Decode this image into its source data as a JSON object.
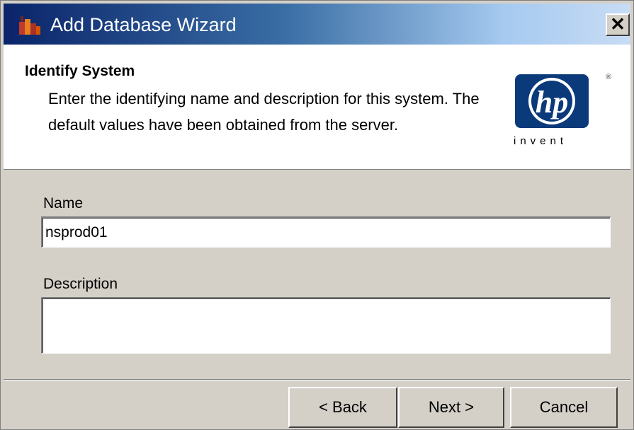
{
  "window": {
    "title": "Add Database Wizard",
    "close_glyph": "✕",
    "app_icon": "database-icon"
  },
  "header": {
    "title": "Identify System",
    "description": "Enter the identifying name and description for this system. The default values have been obtained from the server.",
    "logo": {
      "mark": "hp",
      "tagline": "invent",
      "registered": "®",
      "brand_color": "#0a3a7a"
    }
  },
  "form": {
    "name_label": "Name",
    "name_value": "nsprod01",
    "description_label": "Description",
    "description_value": ""
  },
  "buttons": {
    "back": "< Back",
    "next": "Next >",
    "cancel": "Cancel"
  },
  "colors": {
    "titlebar_start": "#0a246a",
    "titlebar_end": "#c8dcf4",
    "dialog_face": "#d4d0c8"
  }
}
